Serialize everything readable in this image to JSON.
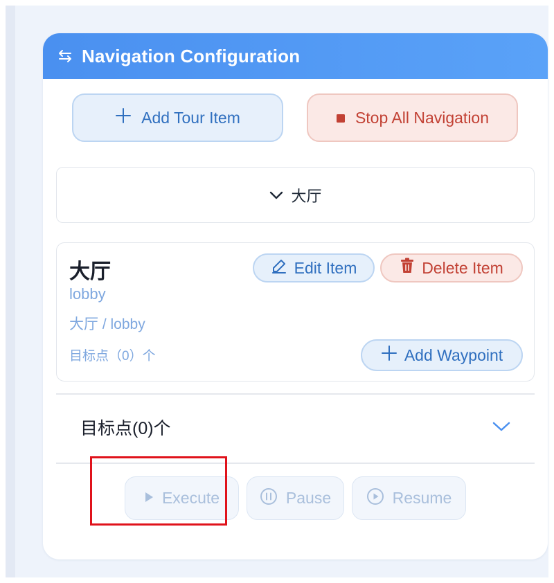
{
  "header": {
    "title": "Navigation Configuration",
    "icon": "swap-arrows-icon"
  },
  "toolbar": {
    "add_tour_label": "Add Tour Item",
    "stop_all_label": "Stop All Navigation"
  },
  "collapse": {
    "label": "大厅"
  },
  "item": {
    "title": "大厅",
    "subtitle": "lobby",
    "path": "大厅 / lobby",
    "waypoint_count_text": "目标点（0）个",
    "edit_label": "Edit Item",
    "delete_label": "Delete Item",
    "add_waypoint_label": "Add Waypoint"
  },
  "waypoints": {
    "label": "目标点(0)个"
  },
  "controls": {
    "execute_label": "Execute",
    "pause_label": "Pause",
    "resume_label": "Resume"
  },
  "colors": {
    "header_blue": "#4a90f0",
    "primary": "#2f6fbf",
    "danger": "#c24134",
    "highlight": "#e0121b"
  }
}
